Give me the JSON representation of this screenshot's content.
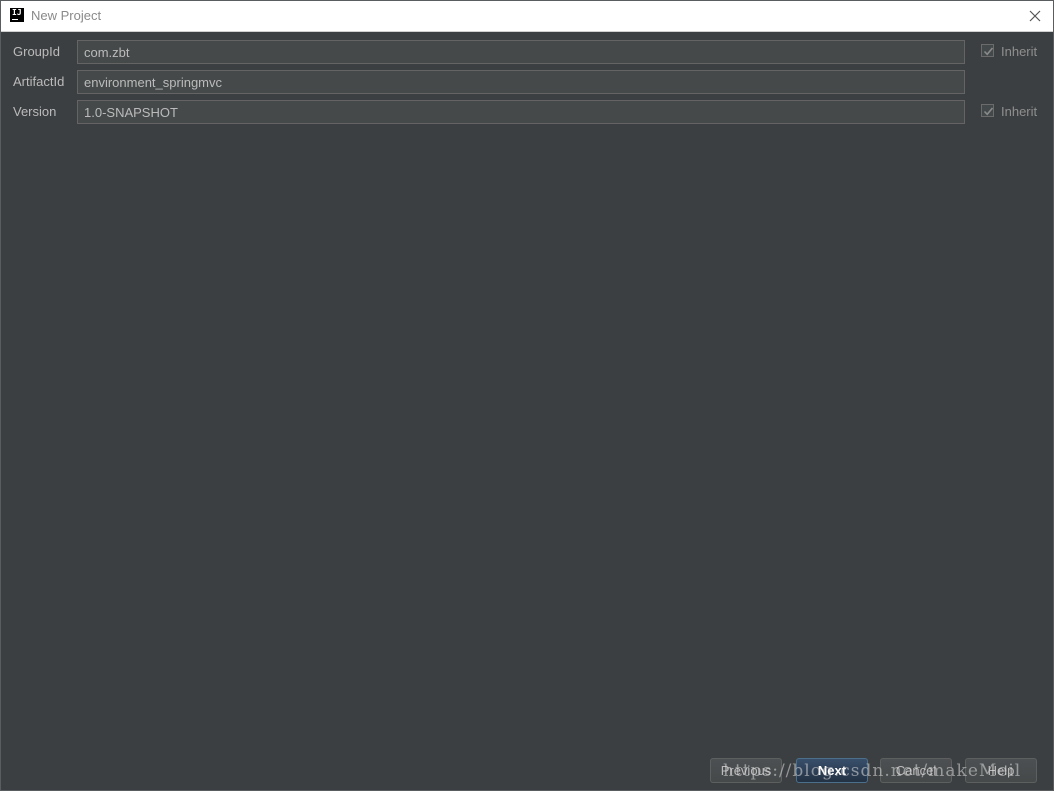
{
  "window": {
    "title": "New Project",
    "app_icon_text": "IJ"
  },
  "form": {
    "group_id": {
      "label": "GroupId",
      "value": "com.zbt",
      "inherit_label": "Inherit",
      "inherit_checked": true
    },
    "artifact_id": {
      "label": "ArtifactId",
      "value": "environment_springmvc"
    },
    "version": {
      "label": "Version",
      "value": "1.0-SNAPSHOT",
      "inherit_label": "Inherit",
      "inherit_checked": true
    }
  },
  "buttons": {
    "previous": "Previous",
    "next": "Next",
    "cancel": "Cancel",
    "help": "Help"
  },
  "watermark": "https://blog.csdn.net/makeMeil",
  "colors": {
    "background": "#3c3f41",
    "field": "#45494a",
    "primary_button": "#365880"
  }
}
